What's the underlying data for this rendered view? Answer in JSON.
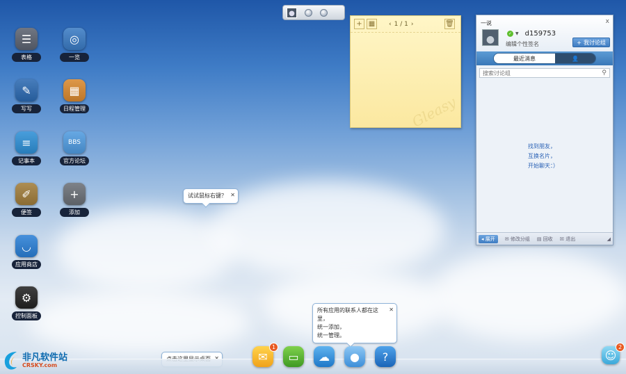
{
  "desktop_icons": [
    {
      "label": "表格",
      "icon": "table-icon",
      "glyph": "☰",
      "color": "#5b6270"
    },
    {
      "label": "一览",
      "icon": "globe-icon",
      "glyph": "◎",
      "color": "#3a7bc4"
    },
    {
      "label": "写写",
      "icon": "pen-icon",
      "glyph": "✎",
      "color": "#2b69b1"
    },
    {
      "label": "日程管理",
      "icon": "calendar-icon",
      "glyph": "▦",
      "color": "#d9882e"
    },
    {
      "label": "记事本",
      "icon": "notepad-icon",
      "glyph": "≡",
      "color": "#2d8fd6"
    },
    {
      "label": "官方论坛",
      "icon": "bbs-icon",
      "glyph": "BBS",
      "color": "#4f9be0"
    },
    {
      "label": "便签",
      "icon": "note-icon",
      "glyph": "✐",
      "color": "#a07c3a"
    },
    {
      "label": "添加",
      "icon": "plus-icon",
      "glyph": "+",
      "color": "#6a6f76"
    },
    {
      "label": "应用商店",
      "icon": "store-icon",
      "glyph": "◡",
      "color": "#2a7fd6"
    },
    {
      "label": "控制面板",
      "icon": "gear-icon",
      "glyph": "⚙",
      "color": "#222"
    }
  ],
  "sticky_note": {
    "page": "1 / 1",
    "prev": "‹",
    "next": "›",
    "watermark": "Gleasy"
  },
  "chat_panel": {
    "title": "一说",
    "close": "x",
    "username": "d159753",
    "signature": "编辑个性签名",
    "find_button": "我讨论组",
    "tabs": [
      "最近消息",
      "👤"
    ],
    "search_placeholder": "搜索讨论组",
    "hints": [
      "找到朋友，",
      "互换名片，",
      "开始聊天：）"
    ],
    "footer": {
      "expand": "◂ 展开",
      "edit_group": "修改分组",
      "recycle": "回收",
      "exit": "退出"
    }
  },
  "bubbles": {
    "right_click": "试试鼠标右键？",
    "contacts": [
      "所有应用的联系人都在这里，",
      "统一添加，",
      "统一管理。"
    ],
    "show_desktop": "点击这里显示桌面"
  },
  "dock": {
    "mail_badge": "1",
    "corner_badge": "2"
  },
  "brand": {
    "name": "非凡软件站",
    "domain": "CRSKY.com"
  }
}
